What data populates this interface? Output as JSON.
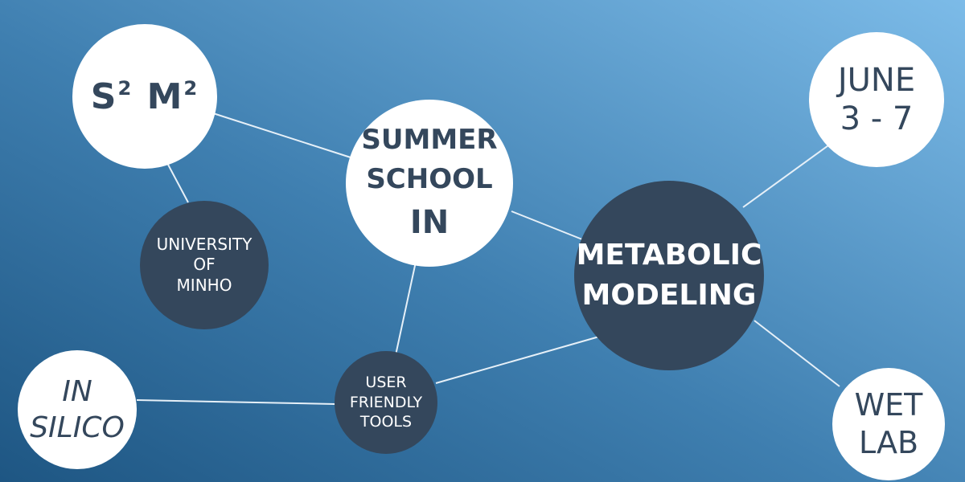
{
  "nodes": {
    "s2m2": {
      "base1": "S",
      "sup1": "2",
      "base2": "M",
      "sup2": "2"
    },
    "summer_school": {
      "line1": "SUMMER",
      "line2": "SCHOOL",
      "line3": "IN"
    },
    "june": {
      "line1": "JUNE",
      "line2": "3 - 7"
    },
    "university": {
      "line1": "UNIVERSITY",
      "line2": "OF",
      "line3": "MINHO"
    },
    "metabolic": {
      "line1": "METABOLIC",
      "line2": "MODELING"
    },
    "in_silico": {
      "line1": "IN",
      "line2": "SILICO"
    },
    "user_tools": {
      "line1": "USER",
      "line2": "FRIENDLY",
      "line3": "TOOLS"
    },
    "wet_lab": {
      "line1": "WET",
      "line2": "LAB"
    }
  },
  "colors": {
    "bg_dark": "#1e5683",
    "bg_light": "#7cbbe8",
    "node_light": "#ffffff",
    "node_dark": "#34475c",
    "link": "#e6f0f8"
  }
}
